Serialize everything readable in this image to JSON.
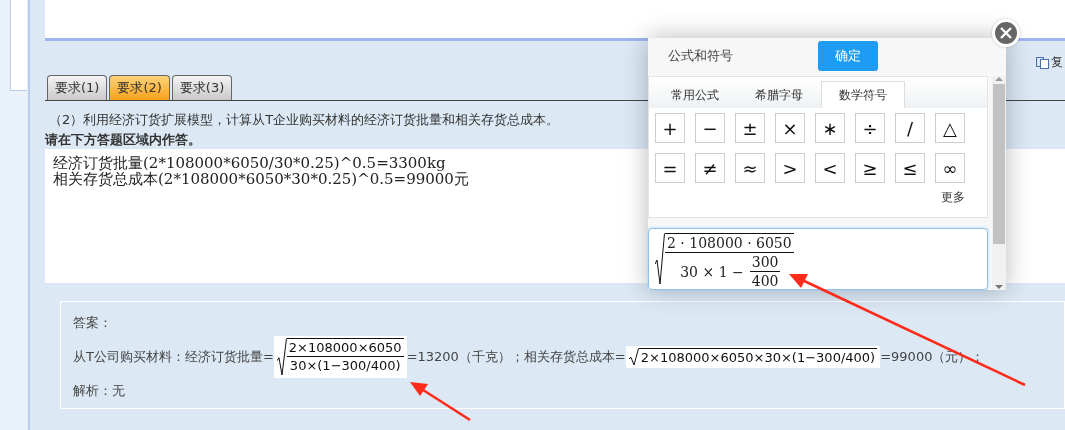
{
  "tabs": [
    {
      "label": "要求(1)",
      "selected": false
    },
    {
      "label": "要求(2)",
      "selected": true
    },
    {
      "label": "要求(3)",
      "selected": false
    }
  ],
  "question": "（2）利用经济订货扩展模型，计算从T企业购买材料的经济订货批量和相关存货总成本。",
  "instruction": "请在下方答题区域内作答。",
  "answer_field": {
    "value": "经济订货批量(2*108000*6050/30*0.25)^0.5=3300kg\n相关存货总成本(2*108000*6050*30*0.25)^0.5=99000元"
  },
  "toolbar_link": "复",
  "answer_key": {
    "heading": "答案：",
    "prefix": "从T公司购买材料：经济订货批量=",
    "formula_1": {
      "numerator": "2×108000×6050",
      "denominator": "30×(1−300/400)"
    },
    "middle": "=13200（千克）；相关存货总成本=",
    "formula_2": {
      "radicand": "2×108000×6050×30×(1−300/400)"
    },
    "suffix": "=99000（元）；",
    "analysis": "解析：无"
  },
  "formula_dialog": {
    "title": "公式和符号",
    "confirm": "确定",
    "tabs": [
      {
        "label": "常用公式",
        "selected": false
      },
      {
        "label": "希腊字母",
        "selected": false
      },
      {
        "label": "数学符号",
        "selected": true
      }
    ],
    "symbols": [
      "+",
      "−",
      "±",
      "×",
      "∗",
      "÷",
      "/",
      "△",
      "=",
      "≠",
      "≈",
      ">",
      "<",
      "≥",
      "≤",
      "∞"
    ],
    "more": "更多",
    "preview": {
      "numerator": "2 · 108000 · 6050",
      "denominator_prefix": "30 × 1 −",
      "fraction_numerator": "300",
      "fraction_denominator": "400"
    }
  }
}
